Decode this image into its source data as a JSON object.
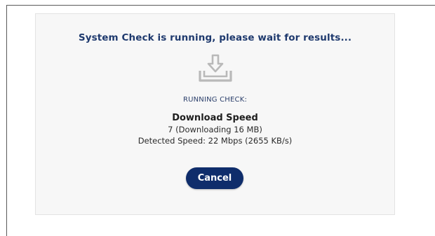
{
  "dialog": {
    "title": "System Check is running, please wait for results...",
    "status_label": "RUNNING CHECK:",
    "check_name": "Download Speed",
    "progress_text": "7 (Downloading 16 MB)",
    "speed_text": "Detected Speed: 22 Mbps (2655 KB/s)",
    "cancel_label": "Cancel"
  },
  "colors": {
    "title": "#1f3a6e",
    "button_background": "#0f2d6b",
    "icon": "#b9b9b9",
    "card_background": "#f7f7f7"
  },
  "icons": {
    "download": "download-tray-icon"
  }
}
